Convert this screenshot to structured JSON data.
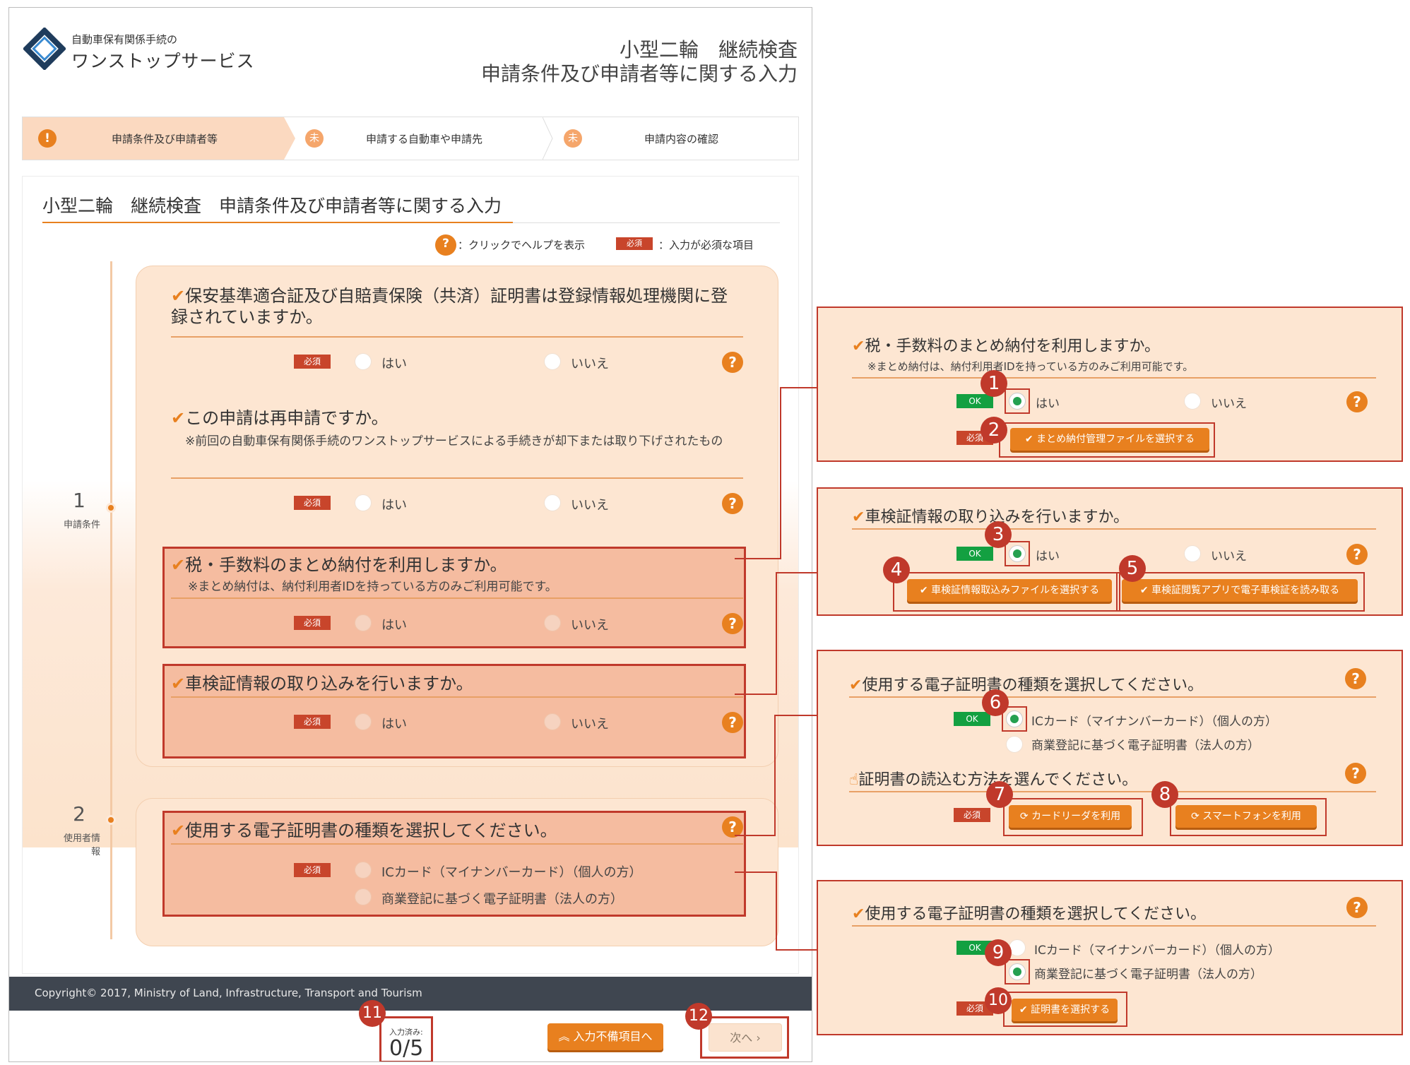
{
  "header": {
    "logo_small": "自動車保有関係手続の",
    "logo_big": "ワンストップサービス",
    "title_line1": "小型二輪　継続検査",
    "title_line2": "申請条件及び申請者等に関する入力"
  },
  "stepper": {
    "steps": [
      {
        "icon": "!",
        "label": "申請条件及び申請者等"
      },
      {
        "icon": "未",
        "label": "申請する自動車や申請先"
      },
      {
        "icon": "未",
        "label": "申請内容の確認"
      }
    ]
  },
  "content": {
    "title": "小型二輪　継続検査　申請条件及び申請者等に関する入力",
    "legend": {
      "help_icon": "?",
      "help_text": "：クリックでヘルプを表示",
      "required_badge": "必須",
      "required_text": "：入力が必須な項目"
    },
    "timeline": [
      {
        "num": "1",
        "label": "申請条件"
      },
      {
        "num": "2",
        "label": "使用者情報"
      }
    ],
    "questions": {
      "q1": {
        "text": "保安基準適合証及び自賠責保険（共済）証明書は登録情報処理機関に登録されていますか。"
      },
      "q2": {
        "text": "この申請は再申請ですか。",
        "note": "※前回の自動車保有関係手続のワンストップサービスによる手続きが却下または取り下げされたもの"
      },
      "q3": {
        "text": "税・手数料のまとめ納付を利用しますか。",
        "note": "※まとめ納付は、納付利用者IDを持っている方のみご利用可能です。"
      },
      "q4": {
        "text": "車検証情報の取り込みを行いますか。"
      },
      "q5": {
        "text": "使用する電子証明書の種類を選択してください。",
        "opt1": "ICカード（マイナンバーカード）（個人の方）",
        "opt2": "商業登記に基づく電子証明書（法人の方）"
      }
    },
    "labels": {
      "yes": "はい",
      "no": "いいえ",
      "required": "必須",
      "ok": "OK",
      "check": "✔",
      "help": "?"
    }
  },
  "footer": {
    "copyright": "Copyright© 2017, Ministry of Land, Infrastructure, Transport and Tourism",
    "counter_label": "入力済み:",
    "counter_value": "0/5",
    "incomplete_button": "入力不備項目へ",
    "next_button": "次へ"
  },
  "callouts": {
    "c1": {
      "question": "税・手数料のまとめ納付を利用しますか。",
      "note": "※まとめ納付は、納付利用者IDを持っている方のみご利用可能です。",
      "yes": "はい",
      "no": "いいえ",
      "button": "まとめ納付管理ファイルを選択する"
    },
    "c2": {
      "question": "車検証情報の取り込みを行いますか。",
      "yes": "はい",
      "no": "いいえ",
      "button1": "車検証情報取込みファイルを選択する",
      "button2": "車検証閲覧アプリで電子車検証を読み取る"
    },
    "c3": {
      "question": "使用する電子証明書の種類を選択してください。",
      "opt1": "ICカード（マイナンバーカード）（個人の方）",
      "opt2": "商業登記に基づく電子証明書（法人の方）",
      "question2": "証明書の読込む方法を選んでください。",
      "button1": "カードリーダを利用",
      "button2": "スマートフォンを利用"
    },
    "c4": {
      "question": "使用する電子証明書の種類を選択してください。",
      "opt1": "ICカード（マイナンバーカード）（個人の方）",
      "opt2": "商業登記に基づく電子証明書（法人の方）",
      "button": "証明書を選択する"
    }
  },
  "badges": [
    "1",
    "2",
    "3",
    "4",
    "5",
    "6",
    "7",
    "8",
    "9",
    "10",
    "11",
    "12"
  ],
  "colors": {
    "accent": "#e8801f",
    "highlight_red": "#c0392b",
    "ok_green": "#13a041",
    "panel_bg": "#fde6d2",
    "footer_bg": "#3f4650"
  }
}
